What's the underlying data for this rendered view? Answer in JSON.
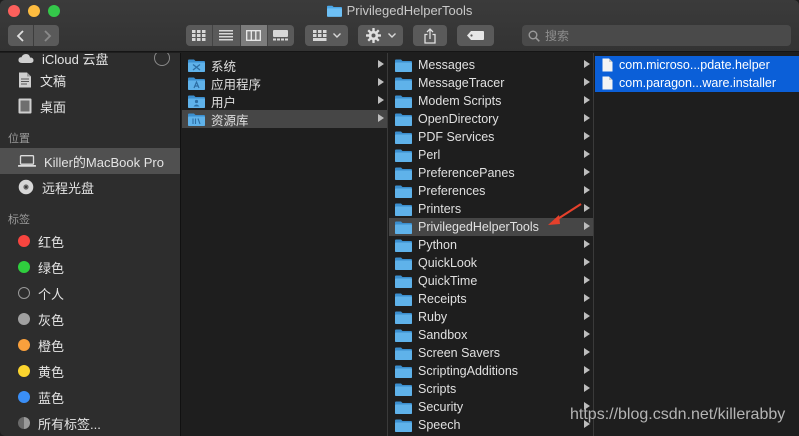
{
  "window": {
    "title": "PrivilegedHelperTools"
  },
  "toolbar": {
    "nav": {
      "back_icon": "chevron-left-icon",
      "forward_icon": "chevron-right-icon"
    },
    "views": [
      {
        "icon": "icon-view-icon",
        "active": false
      },
      {
        "icon": "list-view-icon",
        "active": false
      },
      {
        "icon": "column-view-icon",
        "active": true
      },
      {
        "icon": "gallery-view-icon",
        "active": false
      }
    ],
    "group_icon": "group-grid-icon",
    "action_icon": "gear-icon",
    "share_icon": "share-icon",
    "tag_icon": "tag-icon",
    "search": {
      "placeholder": "搜索",
      "value": ""
    }
  },
  "sidebar": {
    "top_items": [
      {
        "label": "iCloud 云盘",
        "icon": "cloud-icon"
      },
      {
        "label": "文稿",
        "icon": "document-icon"
      },
      {
        "label": "桌面",
        "icon": "desktop-icon"
      }
    ],
    "locations_header": "位置",
    "locations": [
      {
        "label": "Killer的MacBook Pro",
        "icon": "laptop-icon",
        "selected": true
      },
      {
        "label": "远程光盘",
        "icon": "disc-icon",
        "selected": false
      }
    ],
    "tags_header": "标签",
    "tags": [
      {
        "label": "红色",
        "color": "#f7453f"
      },
      {
        "label": "绿色",
        "color": "#2fce3e"
      },
      {
        "label": "个人",
        "color": ""
      },
      {
        "label": "灰色",
        "color": "#a0a0a0"
      },
      {
        "label": "橙色",
        "color": "#f9a03c"
      },
      {
        "label": "黄色",
        "color": "#fbd42e"
      },
      {
        "label": "蓝色",
        "color": "#3a8ef6"
      },
      {
        "label": "所有标签...",
        "color": "all"
      }
    ]
  },
  "columns": {
    "col1": [
      {
        "label": "系统",
        "selected": false
      },
      {
        "label": "应用程序",
        "selected": false
      },
      {
        "label": "用户",
        "selected": false
      },
      {
        "label": "资源库",
        "selected": true
      }
    ],
    "col2": [
      {
        "label": "Messages",
        "selected": false
      },
      {
        "label": "MessageTracer",
        "selected": false
      },
      {
        "label": "Modem Scripts",
        "selected": false
      },
      {
        "label": "OpenDirectory",
        "selected": false
      },
      {
        "label": "PDF Services",
        "selected": false
      },
      {
        "label": "Perl",
        "selected": false
      },
      {
        "label": "PreferencePanes",
        "selected": false
      },
      {
        "label": "Preferences",
        "selected": false
      },
      {
        "label": "Printers",
        "selected": false
      },
      {
        "label": "PrivilegedHelperTools",
        "selected": true
      },
      {
        "label": "Python",
        "selected": false
      },
      {
        "label": "QuickLook",
        "selected": false
      },
      {
        "label": "QuickTime",
        "selected": false
      },
      {
        "label": "Receipts",
        "selected": false
      },
      {
        "label": "Ruby",
        "selected": false
      },
      {
        "label": "Sandbox",
        "selected": false
      },
      {
        "label": "Screen Savers",
        "selected": false
      },
      {
        "label": "ScriptingAdditions",
        "selected": false
      },
      {
        "label": "Scripts",
        "selected": false
      },
      {
        "label": "Security",
        "selected": false
      },
      {
        "label": "Speech",
        "selected": false
      }
    ],
    "col3": [
      {
        "label": "com.microso...pdate.helper",
        "selected": true
      },
      {
        "label": "com.paragon...ware.installer",
        "selected": true
      }
    ]
  },
  "watermark": "https://blog.csdn.net/killerabby",
  "colors": {
    "selection_blue": "#0b5fd8",
    "annotation_arrow": "#e5402b"
  }
}
